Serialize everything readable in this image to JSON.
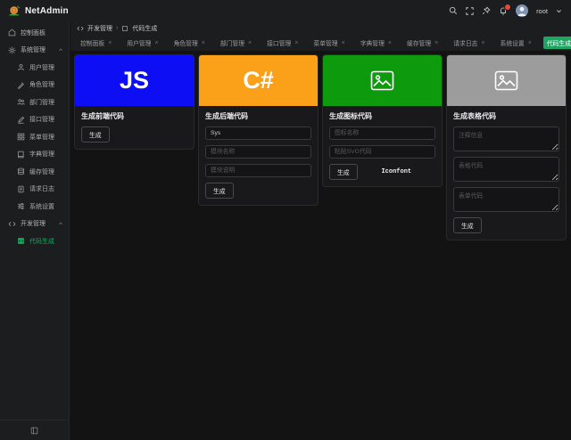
{
  "app": {
    "name": "NetAdmin"
  },
  "topbar": {
    "user": "root"
  },
  "breadcrumb": {
    "section": "开发管理",
    "page": "代码生成"
  },
  "tabs": [
    {
      "label": "控制面板",
      "active": false
    },
    {
      "label": "用户管理",
      "active": false
    },
    {
      "label": "角色管理",
      "active": false
    },
    {
      "label": "部门管理",
      "active": false
    },
    {
      "label": "接口管理",
      "active": false
    },
    {
      "label": "菜单管理",
      "active": false
    },
    {
      "label": "字典管理",
      "active": false
    },
    {
      "label": "缓存管理",
      "active": false
    },
    {
      "label": "请求日志",
      "active": false
    },
    {
      "label": "系统设置",
      "active": false
    },
    {
      "label": "代码生成",
      "active": true
    }
  ],
  "sidebar": {
    "items": [
      {
        "label": "控制面板",
        "icon": "home-icon"
      },
      {
        "label": "系统管理",
        "icon": "gear-icon",
        "group": true,
        "expanded": true
      },
      {
        "label": "用户管理",
        "icon": "user-icon"
      },
      {
        "label": "角色管理",
        "icon": "role-icon"
      },
      {
        "label": "部门管理",
        "icon": "department-icon"
      },
      {
        "label": "接口管理",
        "icon": "api-icon"
      },
      {
        "label": "菜单管理",
        "icon": "menu-grid-icon"
      },
      {
        "label": "字典管理",
        "icon": "dictionary-icon"
      },
      {
        "label": "缓存管理",
        "icon": "cache-icon"
      },
      {
        "label": "请求日志",
        "icon": "log-icon"
      },
      {
        "label": "系统设置",
        "icon": "settings-icon"
      },
      {
        "label": "开发管理",
        "icon": "code-icon",
        "group": true,
        "expanded": true
      },
      {
        "label": "代码生成",
        "icon": "codegen-icon",
        "active": true
      }
    ]
  },
  "cards": [
    {
      "title": "生成前端代码",
      "banner_text": "JS",
      "banner_color": "#0e0ef5",
      "generate_label": "生成"
    },
    {
      "title": "生成后端代码",
      "banner_text": "C#",
      "banner_color": "#fba019",
      "generate_label": "生成",
      "fields": [
        {
          "value": "Sys"
        },
        {
          "placeholder": "模块名称"
        },
        {
          "placeholder": "模块说明"
        }
      ]
    },
    {
      "title": "生成图标代码",
      "banner_color": "#0d9b0d",
      "generate_label": "生成",
      "link_label": "Iconfont",
      "fields": [
        {
          "placeholder": "图标名称"
        },
        {
          "placeholder": "粘贴SVG代码"
        }
      ]
    },
    {
      "title": "生成表格代码",
      "banner_color": "#9c9c9c",
      "generate_label": "生成",
      "fields": [
        {
          "placeholder": "注释信息"
        },
        {
          "placeholder": "表格代码"
        },
        {
          "placeholder": "表单代码"
        }
      ]
    }
  ],
  "colors": {
    "accent": "#1fa562",
    "badge": "#e5493c",
    "banner_js": "#0e0ef5",
    "banner_csharp": "#fba019",
    "banner_icon": "#0d9b0d",
    "banner_table": "#9c9c9c"
  }
}
